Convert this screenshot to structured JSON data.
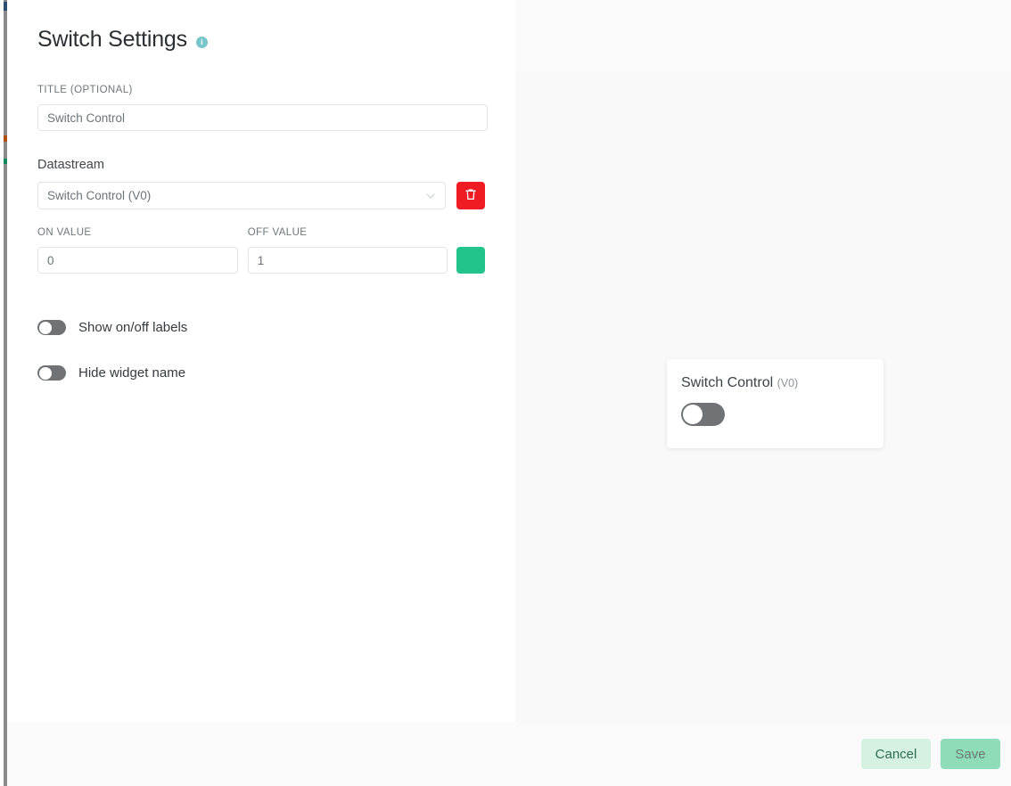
{
  "header": {
    "title": "Switch Settings",
    "info_icon": "info-icon",
    "info_glyph": "i"
  },
  "form": {
    "title_field": {
      "label": "TITLE (OPTIONAL)",
      "value": "Switch Control",
      "placeholder": "Switch Control"
    },
    "datastream": {
      "label": "Datastream",
      "selected": "Switch Control (V0)",
      "chevron_icon": "chevron-down-icon",
      "delete_icon": "trash-icon"
    },
    "on_value": {
      "label": "ON VALUE",
      "value": "0",
      "placeholder": "0"
    },
    "off_value": {
      "label": "OFF VALUE",
      "value": "1",
      "placeholder": "1"
    },
    "color_swatch": {
      "name": "color-swatch",
      "color": "#22c48a"
    },
    "toggles": [
      {
        "label": "Show on/off labels",
        "state": "off"
      },
      {
        "label": "Hide widget name",
        "state": "off"
      }
    ]
  },
  "preview": {
    "widget": {
      "title": "Switch Control",
      "pin": "(V0)",
      "switch_state": "off"
    }
  },
  "footer": {
    "cancel_label": "Cancel",
    "save_label": "Save"
  },
  "colors": {
    "accent_green": "#22c48a",
    "danger_red": "#ef1c26",
    "info_teal": "#77c5c8",
    "save_green": "#8edcb8",
    "cancel_green": "#d4f1e2",
    "toggle_track": "#6f7376",
    "panel_bg": "#f9f9f9"
  }
}
